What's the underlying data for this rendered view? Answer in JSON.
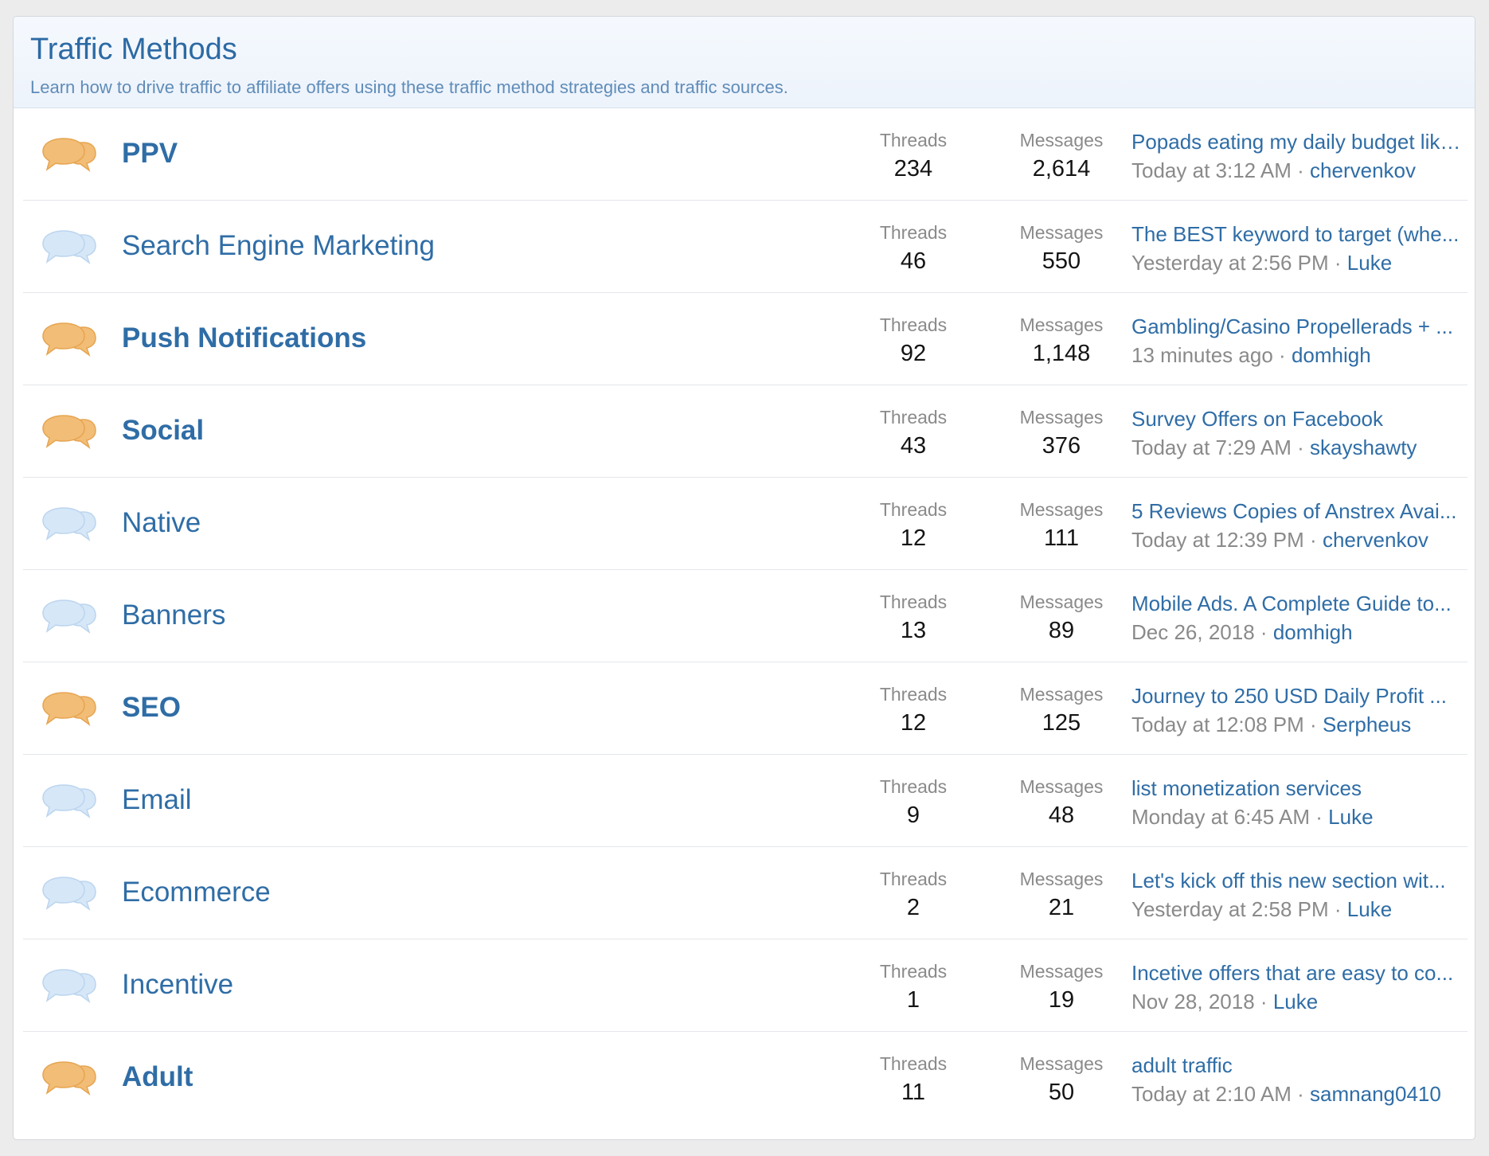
{
  "header": {
    "title": "Traffic Methods",
    "description": "Learn how to drive traffic to affiliate offers using these traffic method strategies and traffic sources."
  },
  "labels": {
    "threads": "Threads",
    "messages": "Messages",
    "separator": "·"
  },
  "colors": {
    "unread_icon": "#f2bd76",
    "read_icon": "#d6e7f8",
    "link": "#2f6da6"
  },
  "nodes": [
    {
      "title": "PPV",
      "unread": true,
      "icon": "chat-bubbles-unread-icon",
      "threads": "234",
      "messages": "2,614",
      "last_post": "Popads eating my daily budget like crazy",
      "last_date": "Today at 3:12 AM",
      "last_user": "chervenkov"
    },
    {
      "title": "Search Engine Marketing",
      "unread": false,
      "icon": "chat-bubbles-read-icon",
      "threads": "46",
      "messages": "550",
      "last_post": "The BEST keyword to target (whe...",
      "last_date": "Yesterday at 2:56 PM",
      "last_user": "Luke"
    },
    {
      "title": "Push Notifications",
      "unread": true,
      "icon": "chat-bubbles-unread-icon",
      "threads": "92",
      "messages": "1,148",
      "last_post": "Gambling/Casino Propellerads + ...",
      "last_date": "13 minutes ago",
      "last_user": "domhigh"
    },
    {
      "title": "Social",
      "unread": true,
      "icon": "chat-bubbles-unread-icon",
      "threads": "43",
      "messages": "376",
      "last_post": "Survey Offers on Facebook",
      "last_date": "Today at 7:29 AM",
      "last_user": "skayshawty"
    },
    {
      "title": "Native",
      "unread": false,
      "icon": "chat-bubbles-read-icon",
      "threads": "12",
      "messages": "111",
      "last_post": "5 Reviews Copies of Anstrex Avai...",
      "last_date": "Today at 12:39 PM",
      "last_user": "chervenkov"
    },
    {
      "title": "Banners",
      "unread": false,
      "icon": "chat-bubbles-read-icon",
      "threads": "13",
      "messages": "89",
      "last_post": "Mobile Ads. A Complete Guide to...",
      "last_date": "Dec 26, 2018",
      "last_user": "domhigh"
    },
    {
      "title": "SEO",
      "unread": true,
      "icon": "chat-bubbles-unread-icon",
      "threads": "12",
      "messages": "125",
      "last_post": "Journey to 250 USD Daily Profit ...",
      "last_date": "Today at 12:08 PM",
      "last_user": "Serpheus"
    },
    {
      "title": "Email",
      "unread": false,
      "icon": "chat-bubbles-read-icon",
      "threads": "9",
      "messages": "48",
      "last_post": "list monetization services",
      "last_date": "Monday at 6:45 AM",
      "last_user": "Luke"
    },
    {
      "title": "Ecommerce",
      "unread": false,
      "icon": "chat-bubbles-read-icon",
      "threads": "2",
      "messages": "21",
      "last_post": "Let's kick off this new section wit...",
      "last_date": "Yesterday at 2:58 PM",
      "last_user": "Luke"
    },
    {
      "title": "Incentive",
      "unread": false,
      "icon": "chat-bubbles-read-icon",
      "threads": "1",
      "messages": "19",
      "last_post": "Incetive offers that are easy to co...",
      "last_date": "Nov 28, 2018",
      "last_user": "Luke"
    },
    {
      "title": "Adult",
      "unread": true,
      "icon": "chat-bubbles-unread-icon",
      "threads": "11",
      "messages": "50",
      "last_post": "adult traffic",
      "last_date": "Today at 2:10 AM",
      "last_user": "samnang0410"
    }
  ]
}
